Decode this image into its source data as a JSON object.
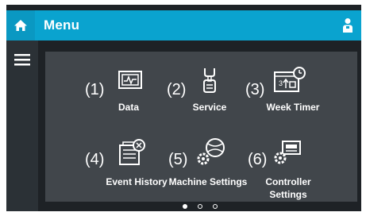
{
  "header": {
    "title": "Menu",
    "home_icon": "home-icon",
    "user_icon": "user-icon"
  },
  "sidebar": {
    "menu_icon": "hamburger-menu-icon"
  },
  "menu_items": [
    {
      "number": "(1)",
      "label": "Data",
      "icon": "chart-monitor-icon"
    },
    {
      "number": "(2)",
      "label": "Service",
      "icon": "service-wrench-icon"
    },
    {
      "number": "(3)",
      "label": "Week Timer",
      "icon": "calendar-timer-icon"
    },
    {
      "number": "(4)",
      "label": "Event History",
      "icon": "event-history-icon"
    },
    {
      "number": "(5)",
      "label": "Machine Settings",
      "icon": "machine-settings-icon"
    },
    {
      "number": "(6)",
      "label_line1": "Controller",
      "label_line2": "Settings",
      "icon": "controller-settings-icon"
    }
  ],
  "pagination": {
    "pages": 3,
    "current": 1
  },
  "colors": {
    "header": "#0aa3cf",
    "background": "#1e2226",
    "panel": "#41464b",
    "text": "#ffffff"
  }
}
